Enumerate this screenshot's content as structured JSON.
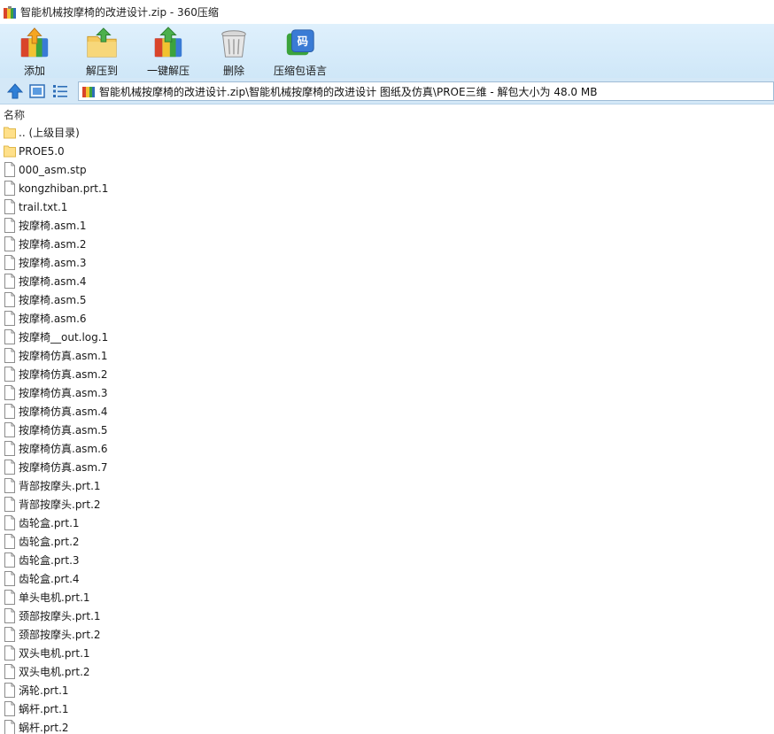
{
  "window": {
    "title": "智能机械按摩椅的改进设计.zip - 360压缩"
  },
  "toolbar": {
    "buttons": [
      {
        "label": "添加",
        "icon": "add-icon"
      },
      {
        "label": "解压到",
        "icon": "extract-to-icon"
      },
      {
        "label": "一键解压",
        "icon": "one-click-extract-icon"
      },
      {
        "label": "删除",
        "icon": "delete-icon"
      },
      {
        "label": "压缩包语言",
        "icon": "archive-language-icon"
      }
    ]
  },
  "address": {
    "path": "智能机械按摩椅的改进设计.zip\\智能机械按摩椅的改进设计 图纸及仿真\\PROE三维 - 解包大小为 48.0 MB"
  },
  "list": {
    "column_name": "名称",
    "items": [
      {
        "name": ".. (上级目录)",
        "type": "folder"
      },
      {
        "name": "PROE5.0",
        "type": "folder"
      },
      {
        "name": "000_asm.stp",
        "type": "file"
      },
      {
        "name": "kongzhiban.prt.1",
        "type": "file"
      },
      {
        "name": "trail.txt.1",
        "type": "file"
      },
      {
        "name": "按摩椅.asm.1",
        "type": "file"
      },
      {
        "name": "按摩椅.asm.2",
        "type": "file"
      },
      {
        "name": "按摩椅.asm.3",
        "type": "file"
      },
      {
        "name": "按摩椅.asm.4",
        "type": "file"
      },
      {
        "name": "按摩椅.asm.5",
        "type": "file"
      },
      {
        "name": "按摩椅.asm.6",
        "type": "file"
      },
      {
        "name": "按摩椅__out.log.1",
        "type": "file"
      },
      {
        "name": "按摩椅仿真.asm.1",
        "type": "file"
      },
      {
        "name": "按摩椅仿真.asm.2",
        "type": "file"
      },
      {
        "name": "按摩椅仿真.asm.3",
        "type": "file"
      },
      {
        "name": "按摩椅仿真.asm.4",
        "type": "file"
      },
      {
        "name": "按摩椅仿真.asm.5",
        "type": "file"
      },
      {
        "name": "按摩椅仿真.asm.6",
        "type": "file"
      },
      {
        "name": "按摩椅仿真.asm.7",
        "type": "file"
      },
      {
        "name": "背部按摩头.prt.1",
        "type": "file"
      },
      {
        "name": "背部按摩头.prt.2",
        "type": "file"
      },
      {
        "name": "齿轮盒.prt.1",
        "type": "file"
      },
      {
        "name": "齿轮盒.prt.2",
        "type": "file"
      },
      {
        "name": "齿轮盒.prt.3",
        "type": "file"
      },
      {
        "name": "齿轮盒.prt.4",
        "type": "file"
      },
      {
        "name": "单头电机.prt.1",
        "type": "file"
      },
      {
        "name": "颈部按摩头.prt.1",
        "type": "file"
      },
      {
        "name": "颈部按摩头.prt.2",
        "type": "file"
      },
      {
        "name": "双头电机.prt.1",
        "type": "file"
      },
      {
        "name": "双头电机.prt.2",
        "type": "file"
      },
      {
        "name": "涡轮.prt.1",
        "type": "file"
      },
      {
        "name": "蜗杆.prt.1",
        "type": "file"
      },
      {
        "name": "蜗杆.prt.2",
        "type": "file"
      }
    ]
  }
}
